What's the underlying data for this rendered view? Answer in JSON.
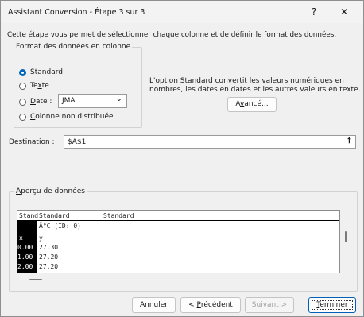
{
  "dialog": {
    "title": "Assistant Conversion - Étape 3 sur 3",
    "help_label": "?",
    "close_label": "✕",
    "intro": "Cette étape vous permet de sélectionner chaque colonne et de définir le format des données."
  },
  "format": {
    "group_label": "Format des données en colonne",
    "options": [
      {
        "prefix": "Sta",
        "hotkey": "n",
        "suffix": "dard",
        "selected": true
      },
      {
        "prefix": "Te",
        "hotkey": "x",
        "suffix": "te",
        "selected": false
      },
      {
        "prefix": "",
        "hotkey": "D",
        "suffix": "ate :",
        "selected": false
      },
      {
        "prefix": "",
        "hotkey": "C",
        "suffix": "olonne non distribuée",
        "selected": false
      }
    ],
    "date_value": "JMA",
    "chevron": "⌄"
  },
  "info": {
    "line1": "L'option Standard convertit les valeurs numériques en",
    "line2": "nombres, les dates en dates et les autres valeurs en texte.",
    "advanced_prefix": "A",
    "advanced_hotkey": "v",
    "advanced_suffix": "ancé..."
  },
  "destination": {
    "label_prefix": "D",
    "label_hotkey": "e",
    "label_suffix": "stination :",
    "value": "$A$1",
    "collapse_icon": "⭡"
  },
  "preview": {
    "label_hotkey": "A",
    "label_suffix": "perçu de données",
    "headers": [
      "Stand",
      "Standard",
      "Standard"
    ],
    "col1": [
      "",
      "x",
      "0.00",
      "1.00",
      "2.00"
    ],
    "col2": [
      "Â°C (ID: 0)",
      "y",
      "27.30",
      "27.20",
      "27.20"
    ]
  },
  "buttons": {
    "cancel": "Annuler",
    "previous_prefix": "< ",
    "previous_hotkey": "P",
    "previous_suffix": "récédent",
    "next": "Suivant >",
    "finish_hotkey": "T",
    "finish_suffix": "erminer"
  }
}
